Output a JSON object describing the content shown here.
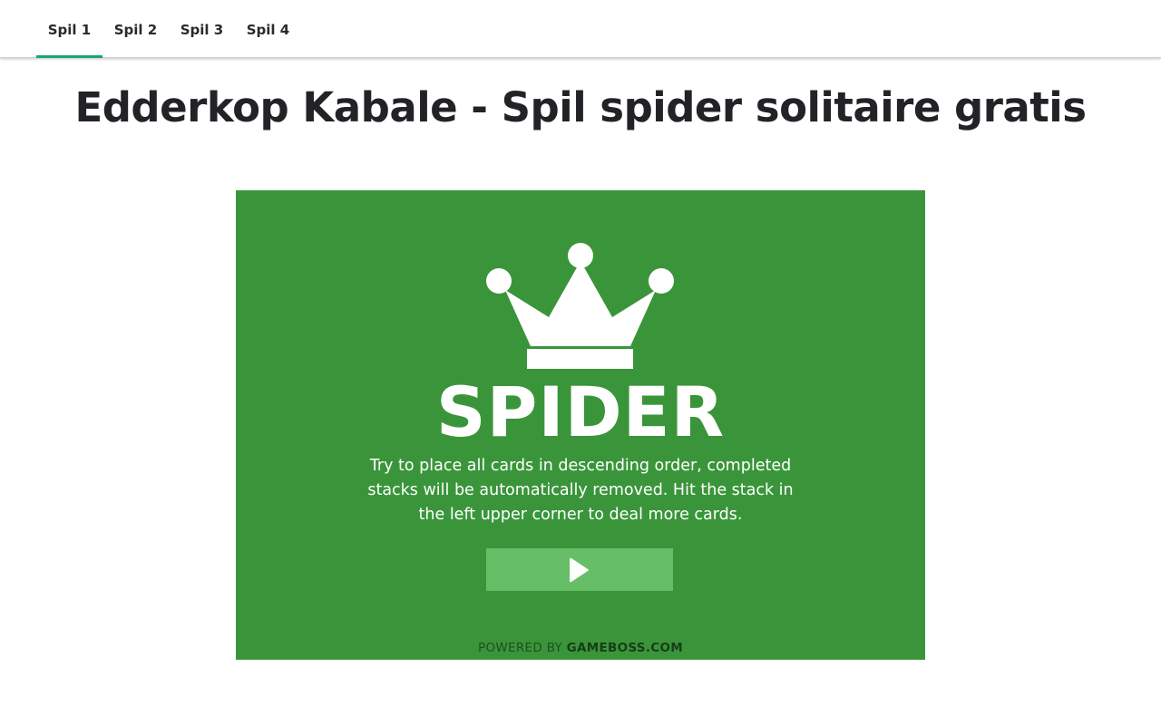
{
  "nav": {
    "tabs": [
      {
        "label": "Spil 1",
        "active": true
      },
      {
        "label": "Spil 2",
        "active": false
      },
      {
        "label": "Spil 3",
        "active": false
      },
      {
        "label": "Spil 4",
        "active": false
      }
    ],
    "accent_color": "#1aa37a"
  },
  "page": {
    "title": "Edderkop Kabale - Spil spider solitaire gratis"
  },
  "game": {
    "background_color": "#3a953a",
    "logo_icon": "crown-icon",
    "title": "SPIDER",
    "instructions": "Try to place all cards in descending order, completed stacks will be automatically removed. Hit the stack in the left upper corner to deal more cards.",
    "play_icon": "play-icon",
    "play_button_color": "#66bf66",
    "powered_by_prefix": "POWERED BY",
    "powered_by_brand": "GAMEBOSS.COM"
  }
}
